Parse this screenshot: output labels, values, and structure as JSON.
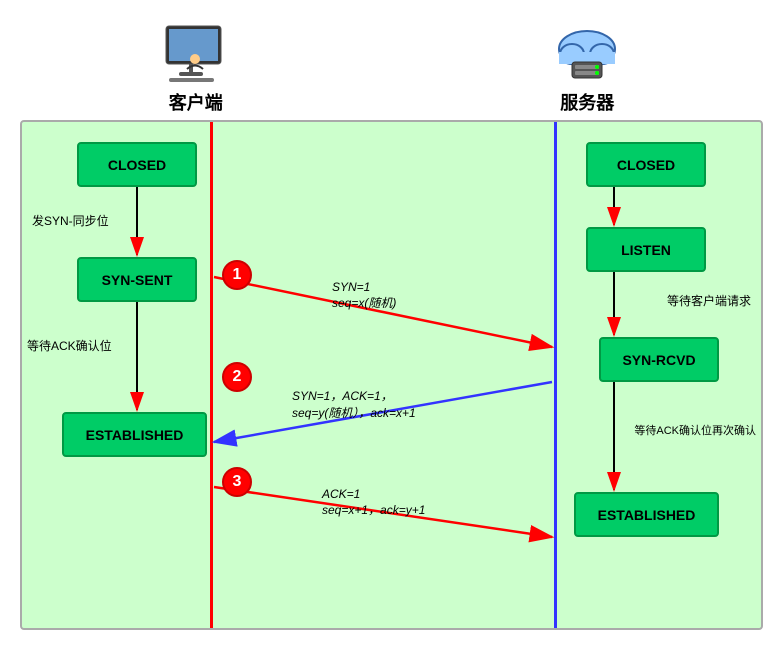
{
  "header": {
    "client_label": "客户端",
    "server_label": "服务器"
  },
  "states": {
    "closed_left": "CLOSED",
    "syn_sent": "SYN-SENT",
    "established_left": "ESTABLISHED",
    "closed_right": "CLOSED",
    "listen": "LISTEN",
    "syn_rcvd": "SYN-RCVD",
    "established_right": "ESTABLISHED"
  },
  "labels": {
    "send_syn": "发SYN-同步位",
    "wait_ack": "等待ACK确认位",
    "wait_client": "等待客户端请求",
    "wait_ack2": "等待ACK确认位再次确认"
  },
  "arrows": {
    "arrow1_label1": "SYN=1",
    "arrow1_label2": "seq=x(随机)",
    "arrow2_label1": "SYN=1，ACK=1，",
    "arrow2_label2": "seq=y(随机），ack=x+1",
    "arrow3_label1": "ACK=1",
    "arrow3_label2": "seq=x+1，ack=y+1"
  },
  "circles": {
    "c1": "1",
    "c2": "2",
    "c3": "3"
  }
}
